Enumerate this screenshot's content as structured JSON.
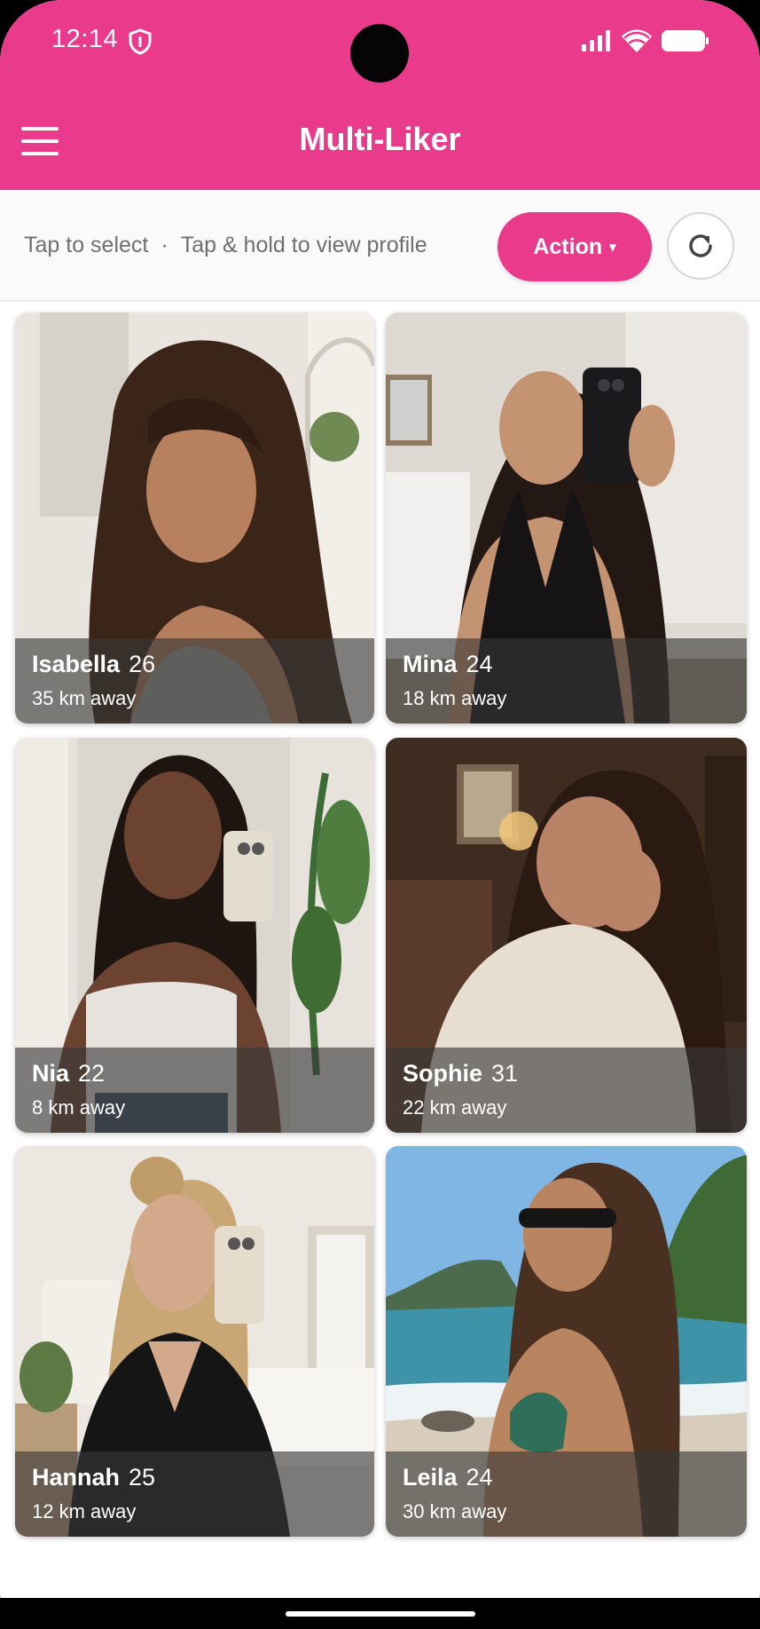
{
  "colors": {
    "accent": "#e93a8c",
    "overlay": "#373737"
  },
  "status_bar": {
    "time": "12:14",
    "icons": [
      "shield-icon",
      "signal-icon",
      "wifi-icon",
      "battery-icon"
    ]
  },
  "app_bar": {
    "title": "Multi-Liker",
    "menu_icon": "hamburger-menu-icon"
  },
  "toolbar": {
    "hint_select": "Tap to select",
    "hint_separator": "·",
    "hint_profile": "Tap & hold to view profile",
    "action_label": "Action",
    "action_caret": "▾",
    "refresh_icon": "refresh-icon"
  },
  "profiles": [
    {
      "name": "Isabella",
      "age": "26",
      "distance": "35 km away"
    },
    {
      "name": "Mina",
      "age": "24",
      "distance": "18 km away"
    },
    {
      "name": "Nia",
      "age": "22",
      "distance": "8 km away"
    },
    {
      "name": "Sophie",
      "age": "31",
      "distance": "22 km away"
    },
    {
      "name": "Hannah",
      "age": "25",
      "distance": "12 km away"
    },
    {
      "name": "Leila",
      "age": "24",
      "distance": "30 km away"
    }
  ]
}
